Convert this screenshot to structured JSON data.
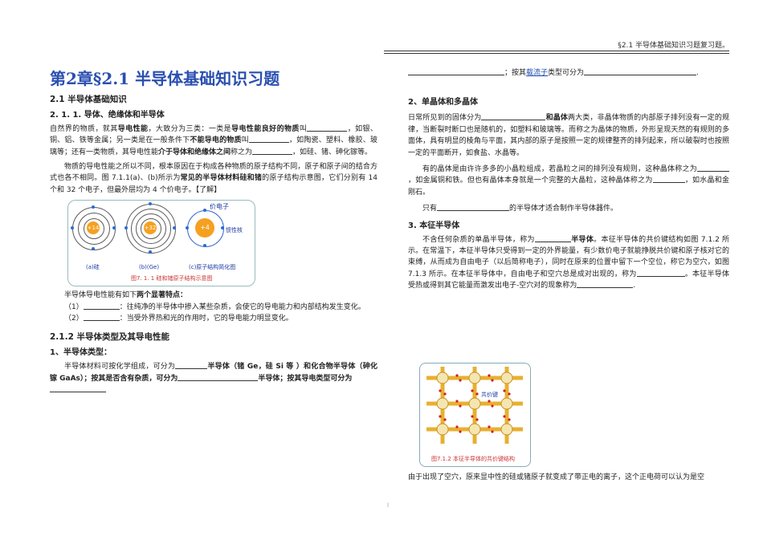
{
  "header": {
    "running_title": "§2.1  半导体基础知识习题复习题。"
  },
  "title": "第2章§2.1 半导体基础知识习题",
  "left": {
    "s21": "2.1      半导体基础知识",
    "s211": "2. 1. 1.  导体、绝缘体和半导体",
    "p1_a": "自然界的物质，就其",
    "p1_b": "导电性能",
    "p1_c": "，大致分为三类：一类是",
    "p1_d": "导电性能良好的物质",
    "p1_e": "叫",
    "p1_f": "，如银、铜、铝、铁等金属；另一类是在一般条件下",
    "p1_g": "不能导电的物质",
    "p1_h": "叫",
    "p1_i": "，如陶瓷、塑料、橡胶、玻璃等；还有一类物质，其导电性能",
    "p1_j": "介于导体和绝缘体之间",
    "p1_k": "称之为",
    "p1_l": "，如硅、锗、砷化镓等。",
    "p2_a": "物质的导电性能之所以不同，根本原因在于构成各种物质的原子结构不同，原子和原子间的结合方式也各不相同。图 7.1.1(a)、(b)所示为",
    "p2_b": "常见的半导体材料硅和锗",
    "p2_c": "的原子结构示意图，它们分别有 14 个和 32 个电子，但最外层均为 4 个价电子。【了解】",
    "fig1": {
      "valence": "价电子",
      "inertia": "惯性核",
      "n1": "+14",
      "n2": "+32",
      "n3": "+4",
      "a_label": "(a)硅",
      "b_label": "(b)(Ge)",
      "c_label": "(c)原子结构简化图",
      "caption": "图7. 1. 1   硅和锗原子结构示意图"
    },
    "p3_a": "半导体导电性能有如下",
    "p3_b": "两个显著特点：",
    "p4_a": "（1）",
    "p4_b": "：往纯净的半导体中掺入某些杂质，会使它的导电能力和内部结构发生变化。",
    "p5_a": "（2）",
    "p5_b": "：当受外界热和光的作用时，它的导电能力明显变化。",
    "s212": "2.1.2      半导体类型及其导电性能",
    "s1": "1、半导体类型：",
    "p6_a": "半导体材料可按化学组成，可分为",
    "p6_b": "半导体（锗 Ge，硅 Si 等  ）和化合物半导体（砷化镓 GaAs）；按其是否含有杂质，可分为",
    "p6_c": "半导体；按其导电类型可分为"
  },
  "right": {
    "p0_a": "；按其",
    "p0_link": "载流子",
    "p0_b": "类型可分为",
    "s2": "2、单晶体和多晶体",
    "p1_a": "日常所见到的固体分为",
    "p1_b": "和晶体",
    "p1_c": "两大类，非晶体物质的内部原子排列没有一定的规律，当断裂时断口也是随机的，如",
    "p1_d": "塑料和玻璃等",
    "p1_e": "。而称之为晶体的物质，外形呈现天然的有规则的多面体，具有明显的棱角与平面，其内部的原子是按照一定的规律整齐的排列起来，所以破裂时也按照一定的平面断开，如食盐、水晶等。",
    "p2_a": "有的晶体是由许许多多的小晶粒组成，若晶粒之间的排列没有规则，这种晶体称之为",
    "p2_b": "，如金属铜和铁。但也有晶体本身就是一个完整的大晶粒，这种晶体称之为",
    "p2_c": "，如水晶和金刚石。",
    "p3_a": "只有",
    "p3_b": "的半导体才适合制作半导体器件。",
    "s3": "3.  本征半导体",
    "p4_a": "不含任何杂质的单晶半导体，称为",
    "p4_b": "半导体",
    "p4_c": "。本征半导体的共价键结构如图 7.1.2 所示。在常温下，本征半导体只受得到一定的外界能量，有少数价电子就能挣脱共价键和原子核对它的束缚，从而成为自由电子（以后简称电子），同时在原来的位置中留下一个空位，称它为空穴，如图 7.1.3 所示。在本征半导体中，自由电子和空穴总是成对出现的，称为",
    "p4_d": "。本征半导体受热或得到其它能量而激发出电子",
    "p4_e": "-空穴对的现象称为",
    "fig2": {
      "bond_label": "共价键",
      "caption": "图7.1.2   本征半导体的共价键结构"
    },
    "p5": "由于出现了空穴，原来显中性的硅或锗原子就变成了带正电的离子，这个正电荷可以认为是空"
  },
  "page_mark": "l"
}
